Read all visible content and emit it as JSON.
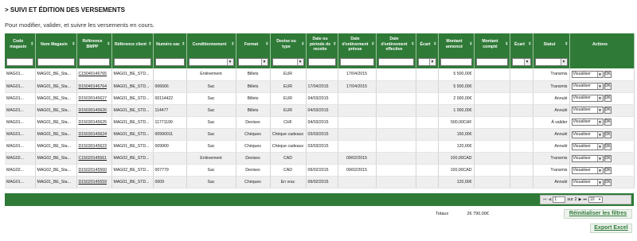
{
  "page": {
    "title": "> SUIVI ET ÉDITION DES VERSEMENTS",
    "subtitle": "Pour modifier, valider, et suivre les versements en cours."
  },
  "columns": [
    {
      "label": "Code magasin",
      "sortable": true
    },
    {
      "label": "Nom Magasin",
      "sortable": true
    },
    {
      "label": "Référence BMPP",
      "sortable": true
    },
    {
      "label": "Référence client",
      "sortable": true
    },
    {
      "label": "Numéro sac",
      "sortable": true
    },
    {
      "label": "Conditionnement",
      "sortable": true
    },
    {
      "label": "Format",
      "sortable": true
    },
    {
      "label": "Devise ou type",
      "sortable": true
    },
    {
      "label": "Date ou période de recette",
      "sortable": true
    },
    {
      "label": "Date d'enlèvement prévue",
      "sortable": true
    },
    {
      "label": "Date d'enlèvement effective",
      "sortable": true
    },
    {
      "label": "Écart",
      "sortable": true
    },
    {
      "label": "Montant annoncé",
      "sortable": true
    },
    {
      "label": "Montant compté",
      "sortable": true
    },
    {
      "label": "Écart",
      "sortable": true
    },
    {
      "label": "Statut",
      "sortable": true
    },
    {
      "label": "Actions",
      "sortable": false
    }
  ],
  "filters": [
    "input",
    "input",
    "input",
    "input",
    "input",
    "select",
    "select",
    "select",
    "input",
    "input",
    "input",
    "select",
    "input",
    "input",
    "select",
    "select",
    "none"
  ],
  "rows": [
    {
      "code": "MAG01...",
      "nom": "MAG01_BE_Sta...",
      "ref_bmpp": "C15040146765",
      "ref_client": "MAG01_BE_STD...",
      "sac": "",
      "cond": "Enlèvement",
      "format": "Billets",
      "devise": "EUR",
      "date_recette": "",
      "date_prevue": "17/04/2015",
      "date_effective": "",
      "ecart1": "",
      "montant_annonce": "5 500,00€",
      "montant_compte": "",
      "ecart2": "",
      "statut": "Transmis",
      "statut_type": "transmis",
      "action": "Visualiser",
      "ok": "OK"
    },
    {
      "code": "MAG01...",
      "nom": "MAG01_BE_Sta...",
      "ref_bmpp": "D15040146764",
      "ref_client": "MAG01_BE_STD...",
      "sac": "006666",
      "cond": "Sac",
      "format": "Billets",
      "devise": "EUR",
      "date_recette": "17/04/2015",
      "date_prevue": "17/04/2015",
      "date_effective": "",
      "ecart1": "",
      "montant_annonce": "5 500,00€",
      "montant_compte": "",
      "ecart2": "",
      "statut": "Transmis",
      "statut_type": "transmis",
      "action": "Visualiser",
      "ok": "OK"
    },
    {
      "code": "MAG01...",
      "nom": "MAG01_BE_Sta...",
      "ref_bmpp": "D15030145627",
      "ref_client": "MAG01_BE_STD...",
      "sac": "00114422",
      "cond": "Sac",
      "format": "Billets",
      "devise": "EUR",
      "date_recette": "04/03/2015",
      "date_prevue": "",
      "date_effective": "",
      "ecart1": "",
      "montant_annonce": "2 000,00€",
      "montant_compte": "",
      "ecart2": "",
      "statut": "Annulé",
      "statut_type": "annule",
      "action": "Visualiser",
      "ok": "OK"
    },
    {
      "code": "MAG01...",
      "nom": "MAG01_BE_Sta...",
      "ref_bmpp": "D15030145626",
      "ref_client": "MAG01_BE_STD...",
      "sac": "114477",
      "cond": "Sac",
      "format": "Billets",
      "devise": "EUR",
      "date_recette": "04/03/2015",
      "date_prevue": "",
      "date_effective": "",
      "ecart1": "",
      "montant_annonce": "1 000,00€",
      "montant_compte": "",
      "ecart2": "",
      "statut": "Annulé",
      "statut_type": "annule",
      "action": "Visualiser",
      "ok": "OK"
    },
    {
      "code": "MAG01...",
      "nom": "MAG01_BE_Sta...",
      "ref_bmpp": "D15030145625",
      "ref_client": "MAG01_BE_STD...",
      "sac": "11771199",
      "cond": "Sac",
      "format": "Devises",
      "devise": "CHF",
      "date_recette": "04/03/2015",
      "date_prevue": "",
      "date_effective": "",
      "ecart1": "",
      "montant_annonce": "500,00CHF",
      "montant_compte": "",
      "ecart2": "",
      "statut": "À valider",
      "statut_type": "valider",
      "action": "Visualiser",
      "ok": "OK"
    },
    {
      "code": "MAG01...",
      "nom": "MAG01_BE_Sta...",
      "ref_bmpp": "D15030145624",
      "ref_client": "MAG01_BE_STD...",
      "sac": "00990011",
      "cond": "Sac",
      "format": "Chèques",
      "devise": "Chèque cadeaux",
      "date_recette": "03/03/2015",
      "date_prevue": "",
      "date_effective": "",
      "ecart1": "",
      "montant_annonce": "150,00€",
      "montant_compte": "",
      "ecart2": "",
      "statut": "Annulé",
      "statut_type": "annule",
      "action": "Visualiser",
      "ok": "OK"
    },
    {
      "code": "MAG01...",
      "nom": "MAG01_BE_Sta...",
      "ref_bmpp": "D15030145623",
      "ref_client": "MAG01_BE_STD...",
      "sac": "009900",
      "cond": "Sac",
      "format": "Chèques",
      "devise": "Chèque cadeaux",
      "date_recette": "03/03/2015",
      "date_prevue": "",
      "date_effective": "",
      "ecart1": "",
      "montant_annonce": "120,00€",
      "montant_compte": "",
      "ecart2": "",
      "statut": "Annulé",
      "statut_type": "annule",
      "action": "Visualiser",
      "ok": "OK"
    },
    {
      "code": "MAG02...",
      "nom": "MAG02_BE_Sta...",
      "ref_bmpp": "C15020145561",
      "ref_client": "MAG02_BE_STD...",
      "sac": "",
      "cond": "Enlèvement",
      "format": "Devises",
      "devise": "CAD",
      "date_recette": "",
      "date_prevue": "09/02/2015",
      "date_effective": "",
      "ecart1": "",
      "montant_annonce": "100,00CAD",
      "montant_compte": "",
      "ecart2": "",
      "statut": "Transmis",
      "statut_type": "transmis",
      "action": "Visualiser",
      "ok": "OK"
    },
    {
      "code": "MAG02...",
      "nom": "MAG02_BE_Sta...",
      "ref_bmpp": "D15020145560",
      "ref_client": "MAG02_BE_STD...",
      "sac": "007779",
      "cond": "Sac",
      "format": "Devises",
      "devise": "CAD",
      "date_recette": "09/02/2015",
      "date_prevue": "09/02/2015",
      "date_effective": "",
      "ecart1": "",
      "montant_annonce": "100,00CAD",
      "montant_compte": "",
      "ecart2": "",
      "statut": "Transmis",
      "statut_type": "transmis",
      "action": "Visualiser",
      "ok": "OK"
    },
    {
      "code": "MAG01...",
      "nom": "MAG01_BE_Sta...",
      "ref_bmpp": "D15020145559",
      "ref_client": "MAG01_BE_STD...",
      "sac": "0009",
      "cond": "Sac",
      "format": "Chèques",
      "devise": "En vrac",
      "date_recette": "09/02/2015",
      "date_prevue": "",
      "date_effective": "",
      "ecart1": "",
      "montant_annonce": "120,00€",
      "montant_compte": "",
      "ecart2": "",
      "statut": "Annulé",
      "statut_type": "annule",
      "action": "Visualiser",
      "ok": "OK"
    }
  ],
  "pager": {
    "first": "⏮",
    "prev": "◀",
    "page": "1",
    "of_label": "sur 2",
    "next": "▶",
    "last": "⏭",
    "per_page": "10"
  },
  "totals": {
    "label": "Totaux",
    "value": "26 790,00€"
  },
  "buttons": {
    "reset": "Réinitialiser les filtres",
    "export": "Export Excel"
  },
  "colors": {
    "header_green": "#2f7a37",
    "status_valider": "#e8890c",
    "status_transmis": "#8a8a8a"
  }
}
